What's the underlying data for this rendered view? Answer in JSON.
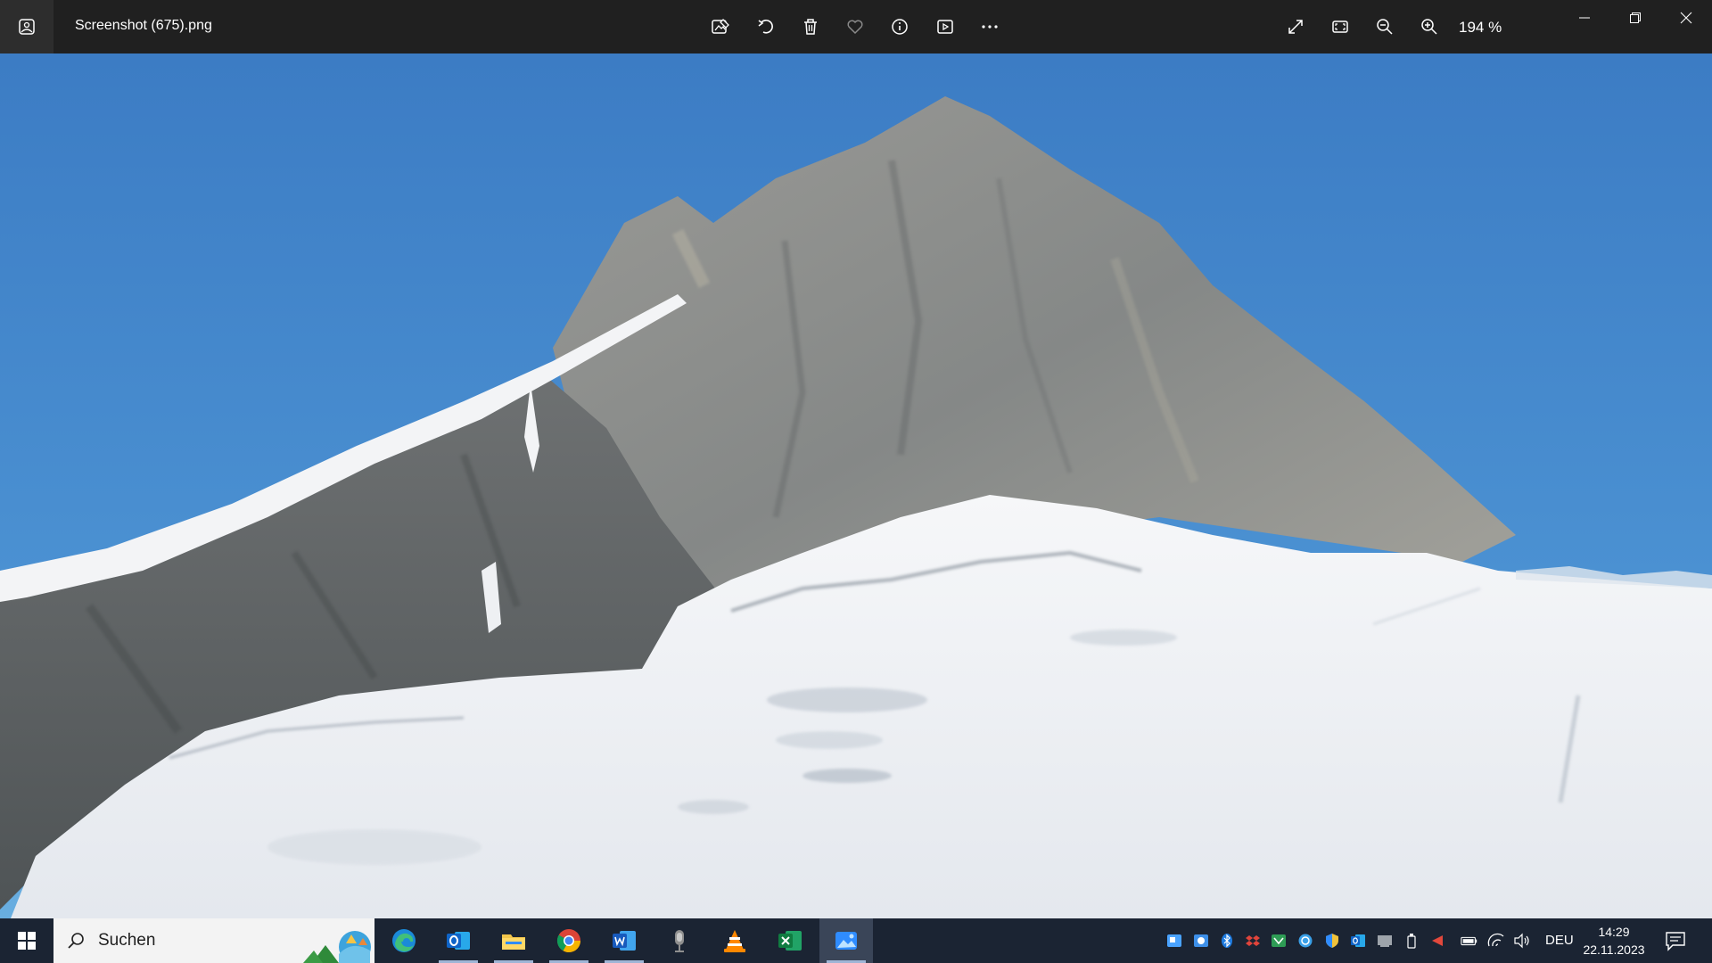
{
  "window": {
    "file_name": "Screenshot (675).png",
    "zoom_level": "194 %"
  },
  "toolbar": {
    "left_icons": [
      "edit-image-icon",
      "rotate-icon",
      "delete-icon",
      "favorite-icon",
      "info-icon",
      "slideshow-icon",
      "more-icon"
    ],
    "right_icons": [
      "fullscreen-icon",
      "fit-to-window-icon",
      "zoom-out-icon",
      "zoom-in-icon"
    ]
  },
  "window_controls": [
    "minimize-icon",
    "restore-icon",
    "close-icon"
  ],
  "image": {
    "subject": "mountain",
    "colors": {
      "sky_top": "#3e7fc6",
      "sky_bottom": "#5aa0da",
      "rock": "#8a8d8f",
      "snow": "#f1f3f6"
    }
  },
  "taskbar": {
    "search_placeholder": "Suchen",
    "apps": [
      "edge",
      "outlook",
      "file-explorer",
      "chrome",
      "word",
      "voice-recorder",
      "vlc",
      "excel",
      "photos"
    ],
    "active_app": "photos",
    "tray_icons": [
      "app-tray-1",
      "app-tray-2",
      "bluetooth",
      "dropbox",
      "tray-5",
      "tray-6",
      "security",
      "outlook-tray",
      "tray-9",
      "usb",
      "tray-11",
      "battery",
      "wifi",
      "volume"
    ],
    "language": "DEU",
    "time": "14:29",
    "date": "22.11.2023"
  },
  "colors": {
    "titlebar": "#202020",
    "taskbar": "#1b2433",
    "accent": "#2f8cff"
  }
}
